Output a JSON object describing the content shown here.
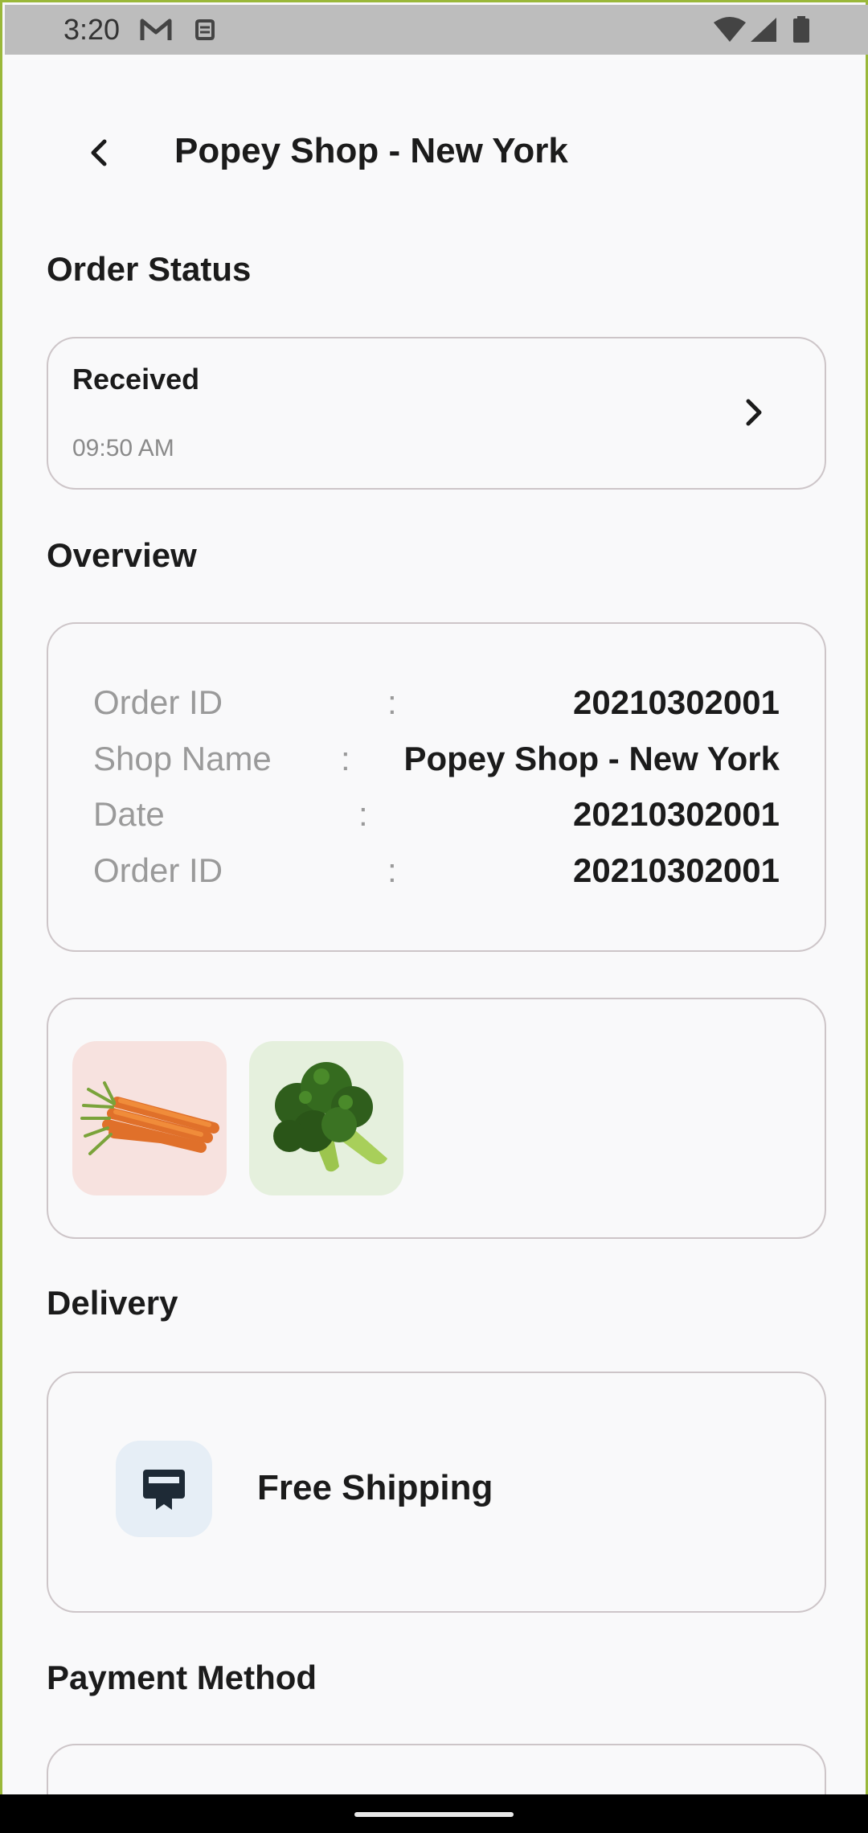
{
  "status_bar": {
    "time": "3:20",
    "icons": [
      "gmail-icon",
      "sim-icon",
      "wifi-icon",
      "signal-icon",
      "battery-icon"
    ]
  },
  "header": {
    "back_icon": "chevron-left-icon",
    "title": "Popey Shop - New York"
  },
  "order_status": {
    "section_title": "Order Status",
    "status": "Received",
    "time": "09:50 AM"
  },
  "overview": {
    "section_title": "Overview",
    "rows": [
      {
        "label": "Order ID",
        "value": "20210302001"
      },
      {
        "label": "Shop Name",
        "value": "Popey Shop - New York"
      },
      {
        "label": "Date",
        "value": "20210302001"
      },
      {
        "label": "Order ID",
        "value": "20210302001"
      }
    ],
    "separator": ":"
  },
  "items": {
    "thumbnails": [
      "carrot",
      "broccoli"
    ]
  },
  "delivery": {
    "section_title": "Delivery",
    "icon": "delivery-icon",
    "method": "Free Shipping"
  },
  "payment": {
    "section_title": "Payment Method"
  },
  "colors": {
    "accent_frame": "#9ab83a",
    "card_border": "#cdc5c8",
    "carrot_bg": "#f7e2df",
    "broccoli_bg": "#e5f0dd",
    "delivery_icon_bg": "#e6eef6"
  }
}
